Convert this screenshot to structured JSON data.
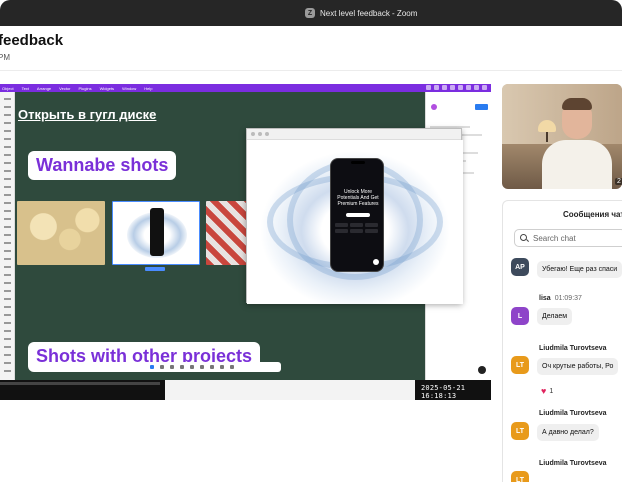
{
  "window": {
    "title": "Next level feedback - Zoom",
    "logo": "Z"
  },
  "header": {
    "title": "feedback",
    "subtitle": "PM"
  },
  "shared_screen": {
    "figma_menu": [
      "Object",
      "Text",
      "Arrange",
      "Vector",
      "Plugins",
      "Widgets",
      "Window",
      "Help"
    ],
    "canvas_title": "Открыть в гугл диске",
    "chip_top": "Wannabe shots",
    "chip_bottom": "Shots with other projects",
    "phone_headline": "Unlock More Potentials And Get Premium Features",
    "timestamp": "2025-05-21 16:18:13"
  },
  "video": {
    "participant_count": "2"
  },
  "chat": {
    "title": "Сообщения чат",
    "search_placeholder": "Search chat",
    "messages": [
      {
        "initials": "AP",
        "avatar_color": "#3d4a5c",
        "sender": "",
        "time": "",
        "text": "Убегаю! Еще раз спаси"
      },
      {
        "initials": "L",
        "avatar_color": "#8e44c9",
        "sender": "lisa",
        "time": "01:09:37",
        "text": "Делаем"
      },
      {
        "initials": "LT",
        "avatar_color": "#e89a1b",
        "sender": "Liudmila Turovtseva",
        "time": "",
        "text": "Оч крутые работы, Ро",
        "reaction": "1"
      },
      {
        "initials": "LT",
        "avatar_color": "#e89a1b",
        "sender": "Liudmila Turovtseva",
        "time": "",
        "text": "А давно делал?"
      },
      {
        "initials": "LT",
        "avatar_color": "#e89a1b",
        "sender": "Liudmila Turovtseva",
        "time": "",
        "text": ""
      }
    ]
  }
}
